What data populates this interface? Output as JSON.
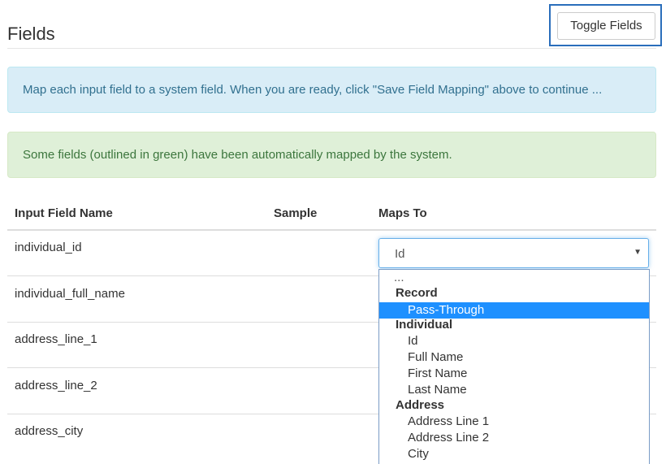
{
  "page": {
    "title": "Fields",
    "toggle_label": "Toggle Fields"
  },
  "alerts": {
    "info": "Map each input field to a system field. When you are ready, click \"Save Field Mapping\" above to continue ...",
    "success": "Some fields (outlined in green) have been automatically mapped by the system."
  },
  "table": {
    "headers": {
      "name": "Input Field Name",
      "sample": "Sample",
      "maps_to": "Maps To"
    },
    "rows": [
      {
        "name": "individual_id"
      },
      {
        "name": "individual_full_name"
      },
      {
        "name": "address_line_1"
      },
      {
        "name": "address_line_2"
      },
      {
        "name": "address_city"
      }
    ]
  },
  "select": {
    "value": "Id",
    "options": [
      {
        "label": "...",
        "kind": "blank"
      },
      {
        "label": "Record",
        "kind": "group"
      },
      {
        "label": "Pass-Through",
        "kind": "item",
        "highlighted": true
      },
      {
        "label": "Individual",
        "kind": "group"
      },
      {
        "label": "Id",
        "kind": "item"
      },
      {
        "label": "Full Name",
        "kind": "item"
      },
      {
        "label": "First Name",
        "kind": "item"
      },
      {
        "label": "Last Name",
        "kind": "item"
      },
      {
        "label": "Address",
        "kind": "group"
      },
      {
        "label": "Address Line 1",
        "kind": "item"
      },
      {
        "label": "Address Line 2",
        "kind": "item"
      },
      {
        "label": "City",
        "kind": "item"
      }
    ]
  },
  "colors": {
    "info_bg": "#d9edf7",
    "success_bg": "#dff0d8",
    "highlight": "#1e90ff",
    "focus_border": "#66afe9"
  }
}
